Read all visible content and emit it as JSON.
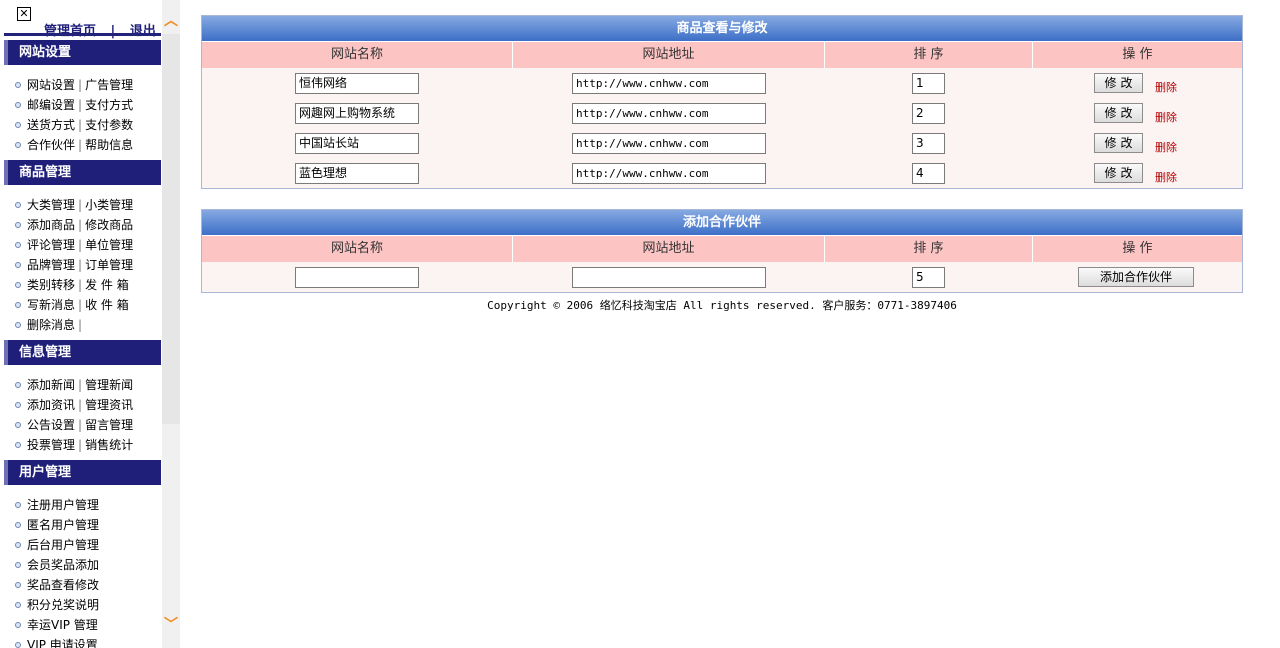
{
  "sidebar": {
    "top": {
      "home_label": "管理首页",
      "separator": "|",
      "logout_label": "退出"
    },
    "sections": [
      {
        "title": "网站设置",
        "rows": [
          [
            "网站设置",
            "广告管理"
          ],
          [
            "邮编设置",
            "支付方式"
          ],
          [
            "送货方式",
            "支付参数"
          ],
          [
            "合作伙伴",
            "帮助信息"
          ]
        ]
      },
      {
        "title": "商品管理",
        "rows": [
          [
            "大类管理",
            "小类管理"
          ],
          [
            "添加商品",
            "修改商品"
          ],
          [
            "评论管理",
            "单位管理"
          ],
          [
            "品牌管理",
            "订单管理"
          ],
          [
            "类别转移",
            "发 件 箱"
          ],
          [
            "写新消息",
            "收 件 箱"
          ],
          [
            "删除消息",
            ""
          ]
        ]
      },
      {
        "title": "信息管理",
        "rows": [
          [
            "添加新闻",
            "管理新闻"
          ],
          [
            "添加资讯",
            "管理资讯"
          ],
          [
            "公告设置",
            "留言管理"
          ],
          [
            "投票管理",
            "销售统计"
          ]
        ]
      },
      {
        "title": "用户管理",
        "rows": [
          [
            "注册用户管理"
          ],
          [
            "匿名用户管理"
          ],
          [
            "后台用户管理"
          ],
          [
            "会员奖品添加"
          ],
          [
            "奖品查看修改"
          ],
          [
            "积分兑奖说明"
          ],
          [
            "幸运VIP 管理"
          ],
          [
            "VIP 申请设置"
          ]
        ]
      }
    ]
  },
  "panel_edit": {
    "title": "商品查看与修改",
    "headers": [
      "网站名称",
      "网站地址",
      "排 序",
      "操 作"
    ],
    "rows": [
      {
        "name": "恒伟网络",
        "url": "http://www.cnhww.com",
        "order": "1"
      },
      {
        "name": "网趣网上购物系统",
        "url": "http://www.cnhww.com",
        "order": "2"
      },
      {
        "name": "中国站长站",
        "url": "http://www.cnhww.com",
        "order": "3"
      },
      {
        "name": "蓝色理想",
        "url": "http://www.cnhww.com",
        "order": "4"
      }
    ],
    "edit_label": "修改",
    "delete_label": "删除"
  },
  "panel_add": {
    "title": "添加合作伙伴",
    "headers": [
      "网站名称",
      "网站地址",
      "排 序",
      "操 作"
    ],
    "name_value": "",
    "url_value": "",
    "order_value": "5",
    "add_label": "添加合作伙伴"
  },
  "footer": {
    "text": "Copyright © 2006 络忆科技淘宝店 All rights reserved. 客户服务：0771-3897406"
  },
  "colors": {
    "sidebar_header": "#1f1f7a",
    "title_bar": "#3d6fc7",
    "table_header": "#fdc4c4",
    "row_bg": "#fcf3f3",
    "delete_link": "#b40000",
    "scroll_arrow": "#f28a1c"
  }
}
